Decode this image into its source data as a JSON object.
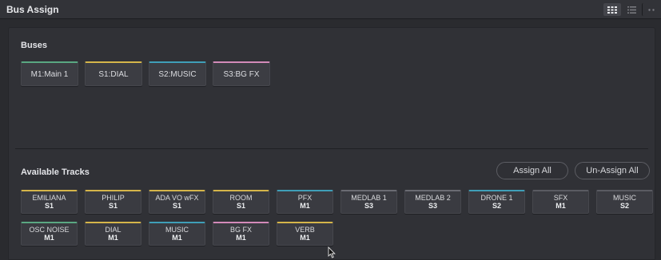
{
  "window": {
    "title": "Bus Assign"
  },
  "icons": {
    "grid_view": "grid-view-icon",
    "list_view": "list-view-icon",
    "options": "more-options-icon"
  },
  "colors": {
    "green": "#5aa882",
    "yellow": "#d5b54a",
    "cyan": "#3f9fb8",
    "pink": "#d38ab9"
  },
  "buses": {
    "label": "Buses",
    "items": [
      {
        "label": "M1:Main 1",
        "color": "#5aa882"
      },
      {
        "label": "S1:DIAL",
        "color": "#d5b54a"
      },
      {
        "label": "S2:MUSIC",
        "color": "#3f9fb8"
      },
      {
        "label": "S3:BG FX",
        "color": "#d38ab9"
      }
    ]
  },
  "tracks": {
    "label": "Available Tracks",
    "assign_all": "Assign All",
    "unassign_all": "Un-Assign All",
    "items": [
      {
        "name": "EMILIANA",
        "bus": "S1",
        "color": "#d5b54a"
      },
      {
        "name": "PHILIP",
        "bus": "S1",
        "color": "#d5b54a"
      },
      {
        "name": "ADA VO wFX",
        "bus": "S1",
        "color": "#d5b54a"
      },
      {
        "name": "ROOM",
        "bus": "S1",
        "color": "#d5b54a"
      },
      {
        "name": "PFX",
        "bus": "M1",
        "color": "#3f9fb8"
      },
      {
        "name": "MEDLAB 1",
        "bus": "S3",
        "color": "#6a6b72"
      },
      {
        "name": "MEDLAB 2",
        "bus": "S3",
        "color": "#6a6b72"
      },
      {
        "name": "DRONE 1",
        "bus": "S2",
        "color": "#3f9fb8"
      },
      {
        "name": "SFX",
        "bus": "M1",
        "color": "#5a5b62"
      },
      {
        "name": "MUSIC",
        "bus": "S2",
        "color": "#5a5b62"
      },
      {
        "name": "OSC NOISE",
        "bus": "M1",
        "color": "#5aa882"
      },
      {
        "name": "DIAL",
        "bus": "M1",
        "color": "#d5b54a"
      },
      {
        "name": "MUSIC",
        "bus": "M1",
        "color": "#3f9fb8"
      },
      {
        "name": "BG FX",
        "bus": "M1",
        "color": "#d38ab9"
      },
      {
        "name": "VERB",
        "bus": "M1",
        "color": "#d5b54a"
      }
    ]
  }
}
